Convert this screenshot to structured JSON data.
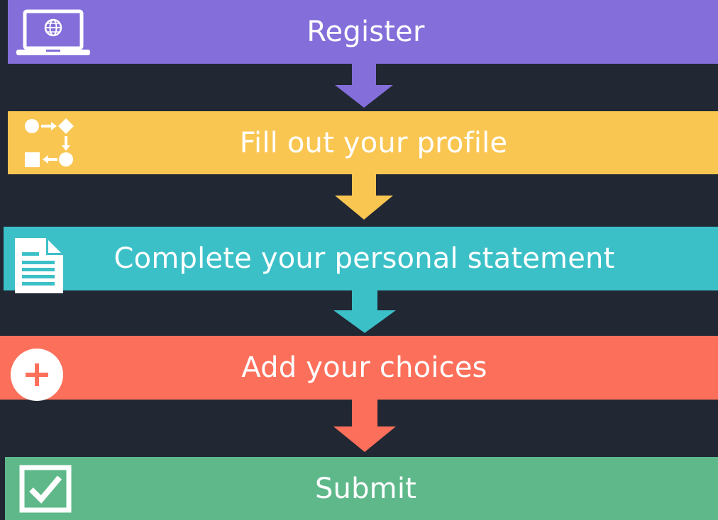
{
  "steps": [
    {
      "label": "Register",
      "color": "#846EDA",
      "icon": "laptop-globe-icon"
    },
    {
      "label": "Fill out your profile",
      "color": "#F9C652",
      "icon": "workflow-icon"
    },
    {
      "label": "Complete your personal statement",
      "color": "#3CC0C8",
      "icon": "document-icon"
    },
    {
      "label": "Add your choices",
      "color": "#FC705B",
      "icon": "plus-circle-icon"
    },
    {
      "label": "Submit",
      "color": "#5EB88A",
      "icon": "checkbox-icon"
    }
  ],
  "background": "#212733"
}
